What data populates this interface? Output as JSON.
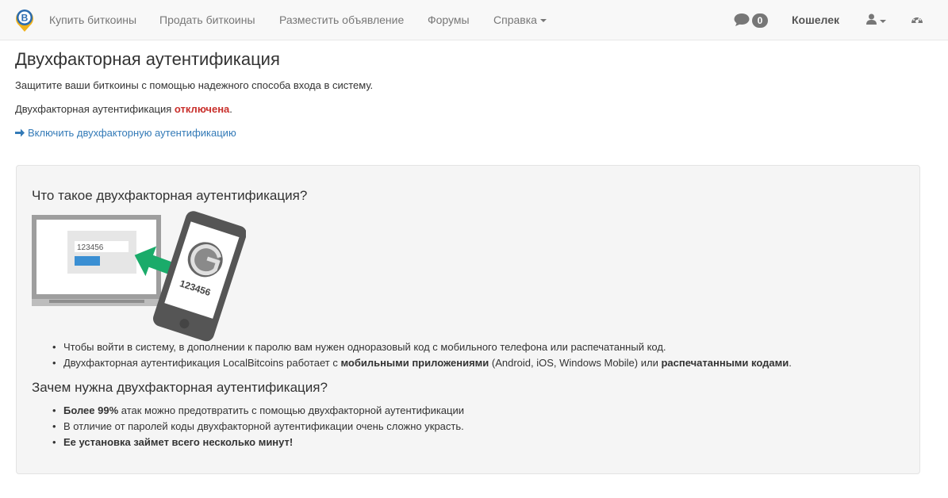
{
  "nav": {
    "buy": "Купить биткоины",
    "sell": "Продать биткоины",
    "post_ad": "Разместить объявление",
    "forums": "Форумы",
    "help": "Справка",
    "messages_count": "0",
    "wallet": "Кошелек"
  },
  "page": {
    "title": "Двухфакторная аутентификация",
    "intro": "Защитите ваши биткоины с помощью надежного способа входа в систему.",
    "status_prefix": "Двухфакторная аутентификация ",
    "status_value": "отключена",
    "status_suffix": ".",
    "enable_link": "Включить двухфакторную аутентификацию"
  },
  "info": {
    "what_title": "Что такое двухфакторная аутентификация?",
    "illustration_code": "123456",
    "what_bullets": {
      "b1": "Чтобы войти в систему, в дополнении к паролю вам нужен одноразовый код с мобильного телефона или распечатанный код.",
      "b2_part1": "Двухфакторная аутентификация LocalBitcoins работает с ",
      "b2_bold1": "мобильными приложениями",
      "b2_part2": " (Android, iOS, Windows Mobile) или ",
      "b2_bold2": "распечатанными кодами",
      "b2_part3": "."
    },
    "why_title": "Зачем нужна двухфакторная аутентификация?",
    "why_bullets": {
      "b1_bold": "Более 99%",
      "b1_rest": " атак можно предотвратить с помощью двухфакторной аутентификации",
      "b2": "В отличие от паролей коды двухфакторной аутентификации очень сложно украсть.",
      "b3_bold": "Ее установка займет всего несколько минут!"
    }
  },
  "colors": {
    "link": "#337ab7",
    "status_off": "#c9302c",
    "arrow_green": "#1aab6a",
    "brand_blue": "#2b6cb0",
    "brand_yellow": "#f0b21b"
  },
  "icons": {
    "brand": "localbitcoins-logo",
    "chat": "comment-icon",
    "user": "user-icon",
    "dashboard": "dashboard-icon",
    "arrow": "arrow-right-icon"
  }
}
